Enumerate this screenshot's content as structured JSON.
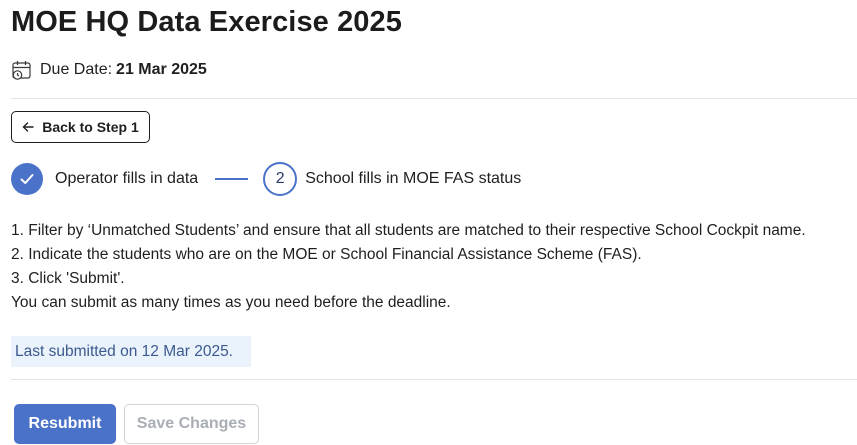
{
  "page": {
    "title": "MOE HQ Data Exercise 2025"
  },
  "due": {
    "icon": "calendar-clock-icon",
    "label": "Due Date:",
    "value": "21 Mar 2025"
  },
  "back_button": {
    "icon": "arrow-left-icon",
    "label": "Back to Step 1"
  },
  "stepper": {
    "accent_color": "#4b72c9",
    "steps": [
      {
        "number": "",
        "label": "Operator fills in data",
        "state": "completed",
        "icon": "checkmark-icon"
      },
      {
        "number": "2",
        "label": "School fills in MOE FAS status",
        "state": "current"
      }
    ]
  },
  "instructions": [
    "1. Filter by ‘Unmatched Students’ and ensure that all students are matched to their respective School Cockpit name.",
    "2. Indicate the students who are on the MOE or School Financial Assistance Scheme (FAS).",
    "3. Click 'Submit'.",
    "You can submit as many times as you need before the deadline."
  ],
  "status": {
    "last_submitted": "Last submitted on 12 Mar 2025.",
    "background_color": "#eaf2fc"
  },
  "actions": {
    "resubmit_label": "Resubmit",
    "save_changes_label": "Save Changes",
    "save_changes_disabled": true,
    "primary_color": "#4b72c9"
  }
}
